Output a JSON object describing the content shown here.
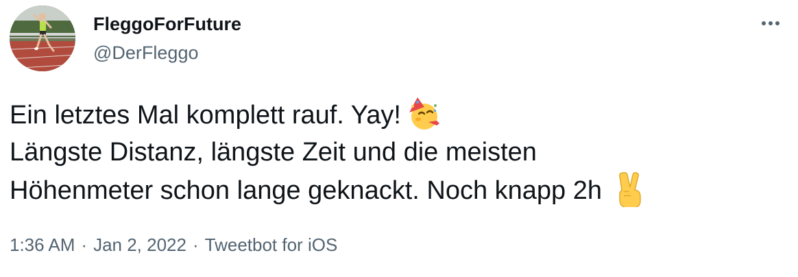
{
  "author": {
    "display_name": "FleggoForFuture",
    "handle": "@DerFleggo",
    "avatar_icon": "runner-on-track-photo"
  },
  "tweet": {
    "lines": [
      "Ein letztes Mal komplett rauf. Yay!",
      "Längste Distanz, längste Zeit und die meisten",
      "Höhenmeter schon lange geknackt. Noch knapp 2h"
    ],
    "emoji_line1": "partying-face-icon",
    "emoji_line3": "victory-hand-icon"
  },
  "meta": {
    "time": "1:36 AM",
    "date": "Jan 2, 2022",
    "separator": "·",
    "source": "Tweetbot for iOS"
  },
  "more_icon": "more-horizontal-icon",
  "colors": {
    "text_primary": "#0f1419",
    "text_secondary": "#536471"
  }
}
